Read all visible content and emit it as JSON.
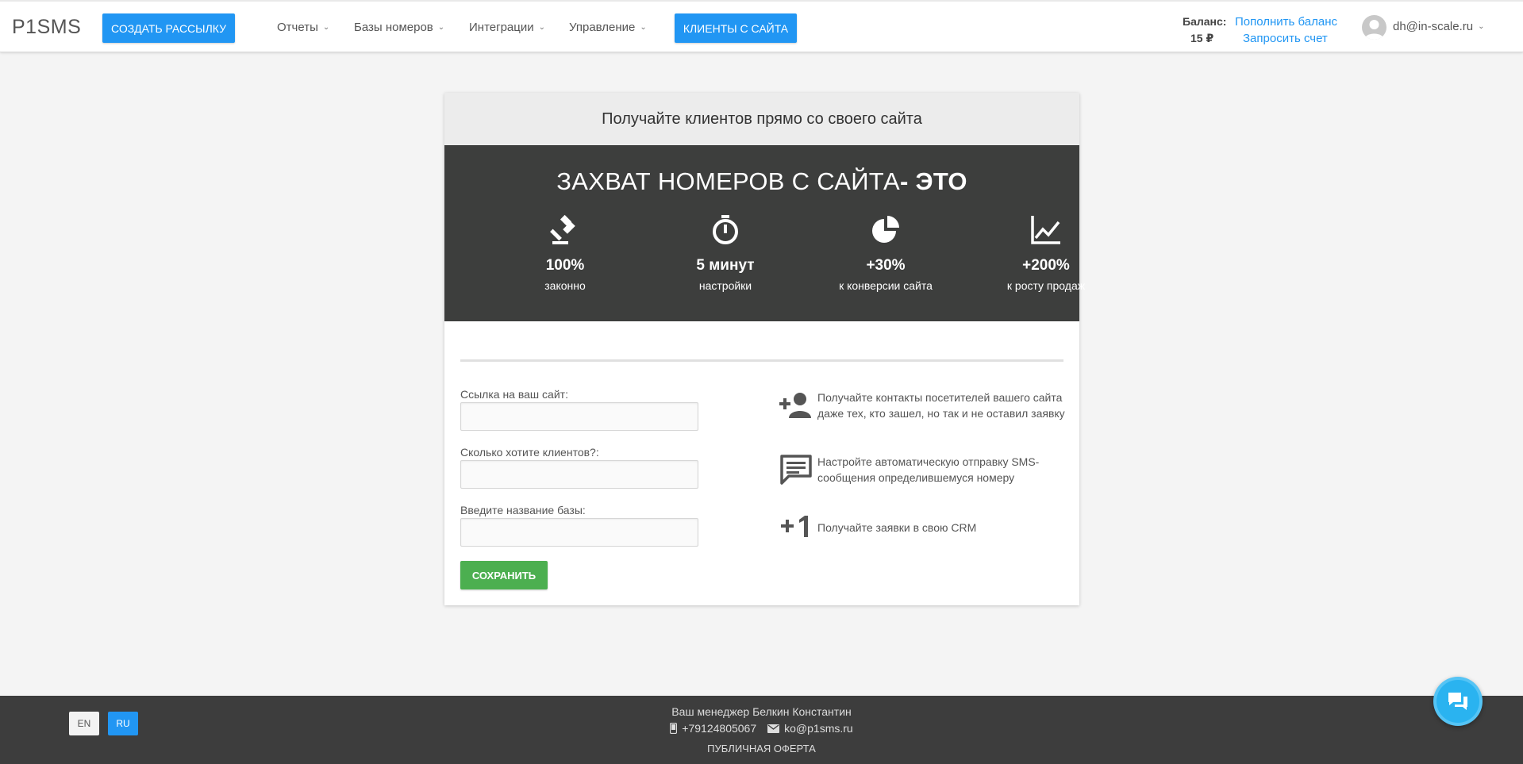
{
  "header": {
    "logo": "P1SMS",
    "create_button": "СОЗДАТЬ РАССЫЛКУ",
    "nav": {
      "reports": "Отчеты",
      "bases": "Базы номеров",
      "integrations": "Интеграции",
      "management": "Управление"
    },
    "clients_button": "КЛИЕНТЫ С САЙТА",
    "balance_label": "Баланс:",
    "balance_value": "15 ₽",
    "topup_link": "Пополнить баланс",
    "invoice_link": "Запросить счет",
    "user_email": "dh@in-scale.ru"
  },
  "card": {
    "heading": "Получайте клиентов прямо со своего сайта",
    "banner_title": "ЗАХВАТ НОМЕРОВ С САЙТА",
    "banner_title_bold": "- ЭТО",
    "features": [
      {
        "icon": "gavel-icon",
        "value": "100%",
        "label": "законно"
      },
      {
        "icon": "timer-icon",
        "value": "5 минут",
        "label": "настройки"
      },
      {
        "icon": "pie-chart-icon",
        "value": "+30%",
        "label": "к конверсии сайта"
      },
      {
        "icon": "line-chart-icon",
        "value": "+200%",
        "label": "к росту продаж"
      }
    ],
    "form": {
      "site_label": "Ссылка на ваш сайт:",
      "site_value": "",
      "clients_label": "Сколько хотите клиентов?:",
      "clients_value": "",
      "base_label": "Введите название базы:",
      "base_value": "",
      "save_button": "СОХРАНИТЬ"
    },
    "info": [
      {
        "icon": "add-person-icon",
        "text": "Получайте контакты посетителей вашего сайта даже тех, кто зашел, но так и не оставил заявку"
      },
      {
        "icon": "message-icon",
        "text": "Настройте автоматическую отправку SMS-сообщения определившемуся номеру"
      },
      {
        "icon": "plus-one-icon",
        "text": "Получайте заявки в свою CRM"
      }
    ]
  },
  "footer": {
    "lang_en": "EN",
    "lang_ru": "RU",
    "manager": "Ваш менеджер Белкин Константин",
    "phone": "+79124805067",
    "email": "ko@p1sms.ru",
    "offer": "ПУБЛИЧНАЯ ОФЕРТА"
  },
  "colors": {
    "accent": "#2196f3",
    "banner_bg": "#3d3e3d",
    "save": "#4caf50",
    "footer_bg": "#3d3d3d",
    "chat": "#2ab3f0"
  }
}
